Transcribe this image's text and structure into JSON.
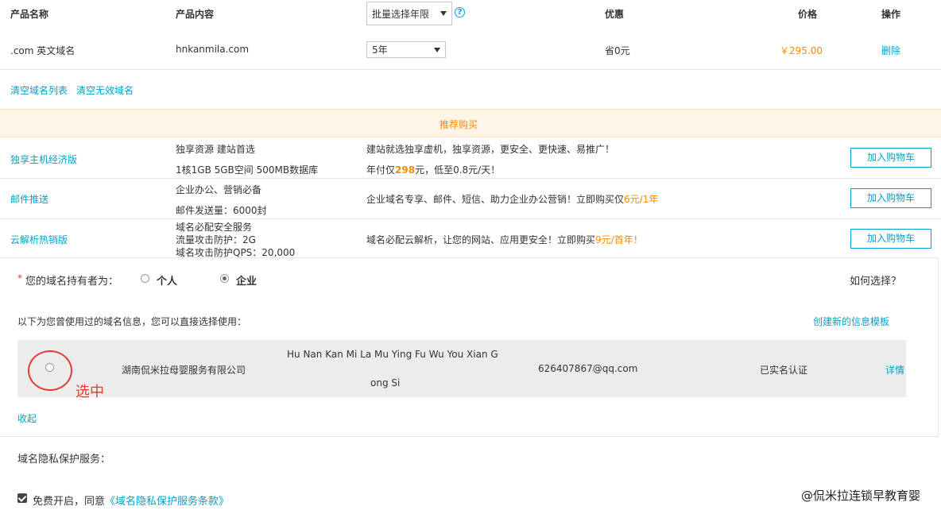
{
  "header": {
    "col_name": "产品名称",
    "col_content": "产品内容",
    "batch_select": "批量选择年限",
    "col_discount": "优惠",
    "col_price": "价格",
    "col_action": "操作"
  },
  "item": {
    "name": ".com 英文域名",
    "domain": "hnkanmila.com",
    "years": "5年",
    "discount": "省0元",
    "price": "￥295.00",
    "delete": "删除"
  },
  "list_actions": {
    "clear_list": "清空域名列表",
    "clear_invalid": "清空无效域名"
  },
  "recommend": {
    "title": "推荐购买",
    "items": [
      {
        "name": "独享主机经济版",
        "content_lines": [
          "独享资源 建站首选",
          "1核1GB 5GB空间 500MB数据库"
        ],
        "desc_line1": "建站就选独享虚机，独享资源，更安全、更快速、易推广！",
        "desc_pre": "年付仅",
        "desc_highlight": "298",
        "desc_post": "元，低至0.8元/天！",
        "button": "加入购物车"
      },
      {
        "name": "邮件推送",
        "content_lines": [
          "企业办公、营销必备",
          "邮件发送量：6000封"
        ],
        "desc_pre": "企业域名专享、邮件、短信、助力企业办公营销！立即购买仅",
        "desc_highlight": "6元/1年",
        "button": "加入购物车"
      },
      {
        "name": "云解析热销版",
        "content_lines": [
          "域名必配安全服务",
          "流量攻击防护：2G",
          "域名攻击防护QPS：20,000"
        ],
        "desc_pre": "域名必配云解析，让您的网站、应用更安全！立即购买",
        "desc_highlight": "9元/首年！",
        "button": "加入购物车"
      }
    ]
  },
  "holder": {
    "required_mark": "*",
    "label": "您的域名持有者为：",
    "option_personal": "个人",
    "option_company": "企业",
    "selected": "企业",
    "how_to_choose": "如何选择？"
  },
  "templates": {
    "hint": "以下为您曾使用过的域名信息，您可以直接选择使用：",
    "create_new": "创建新的信息模板",
    "entry": {
      "company_cn": "湖南侃米拉母婴服务有限公司",
      "company_en_line1": "Hu Nan Kan Mi La Mu Ying Fu Wu You Xian G",
      "company_en_line2": "ong Si",
      "email": "626407867@qq.com",
      "status": "已实名认证",
      "detail": "详情"
    },
    "annotation": "选中",
    "collapse": "收起"
  },
  "privacy": {
    "title": "域名隐私保护服务：",
    "agree_pre": "免费开启，同意",
    "agree_link": "《域名隐私保护服务条款》"
  },
  "watermark": "@侃米拉连锁早教育婴",
  "colors": {
    "link": "#00a2ca",
    "price": "#ff8a00",
    "recommend_bg": "#fff5e6",
    "annotation": "#e53935"
  }
}
